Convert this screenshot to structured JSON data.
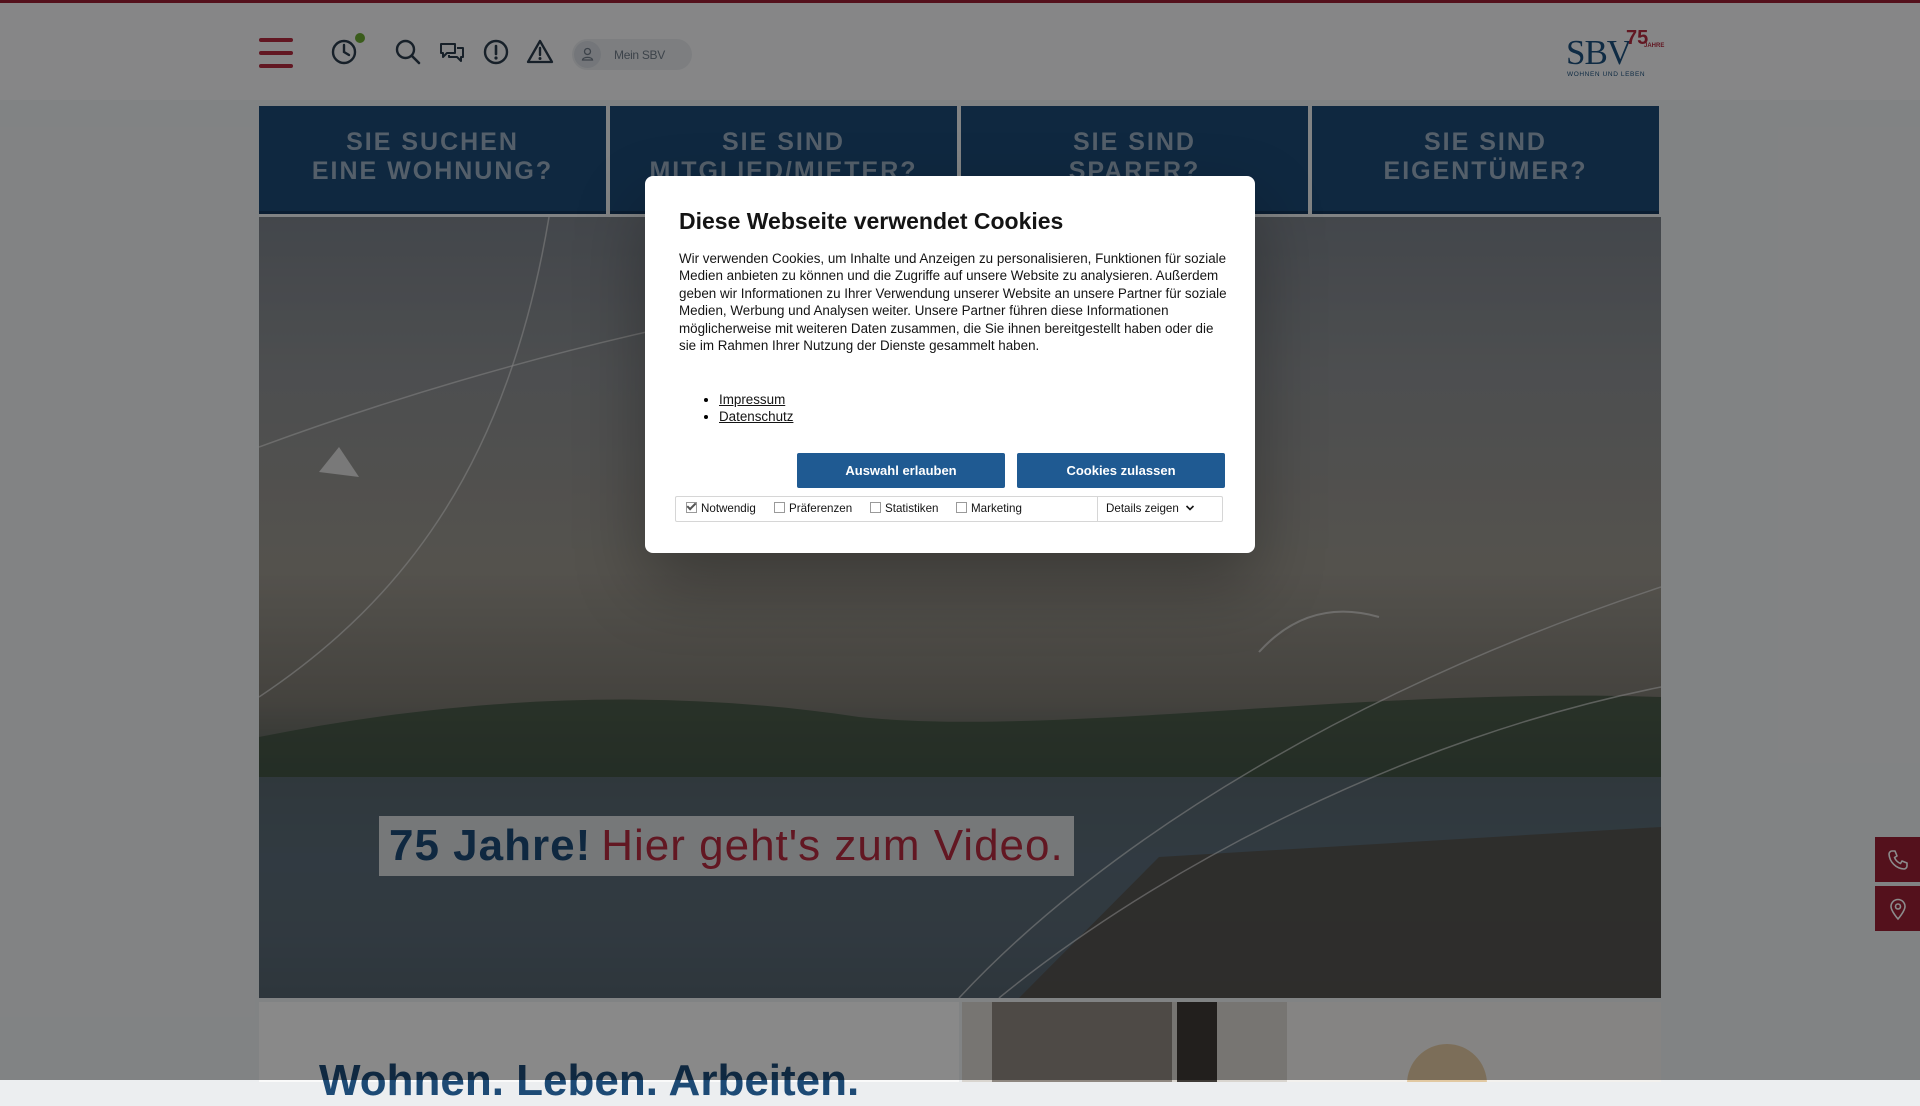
{
  "header": {
    "mein_sbv_label": "Mein SBV",
    "logo": {
      "brand": "SBV",
      "years": "75",
      "years_word": "JAHRE",
      "tagline": "WOHNEN UND LEBEN"
    },
    "icons": [
      "menu-icon",
      "clock-icon",
      "search-icon",
      "chat-icon",
      "info-icon",
      "warning-icon",
      "user-icon"
    ]
  },
  "tiles": [
    {
      "line1": "SIE SUCHEN",
      "line2": "EINE WOHNUNG?"
    },
    {
      "line1": "SIE SIND",
      "line2": "MITGLIED/MIETER?"
    },
    {
      "line1": "SIE SIND",
      "line2": "SPARER?"
    },
    {
      "line1": "SIE SIND",
      "line2": "EIGENTÜMER?"
    }
  ],
  "hero": {
    "caption_bold": "75 Jahre!",
    "caption_link": "Hier geht's zum Video."
  },
  "section": {
    "heading": "Wohnen. Leben. Arbeiten."
  },
  "cookie_dialog": {
    "title": "Diese Webseite verwendet Cookies",
    "body": "Wir verwenden Cookies, um Inhalte und Anzeigen zu personalisieren, Funktionen für soziale Medien anbieten zu können und die Zugriffe auf unsere Website zu analysieren. Außerdem geben wir Informationen zu Ihrer Verwendung unserer Website an unsere Partner für soziale Medien, Werbung und Analysen weiter. Unsere Partner führen diese Informationen möglicherweise mit weiteren Daten zusammen, die Sie ihnen bereitgestellt haben oder die sie im Rahmen Ihrer Nutzung der Dienste gesammelt haben.",
    "links": [
      "Impressum",
      "Datenschutz"
    ],
    "button_selection": "Auswahl erlauben",
    "button_allow": "Cookies zulassen",
    "checkboxes": [
      {
        "label": "Notwendig",
        "checked": true
      },
      {
        "label": "Präferenzen",
        "checked": false
      },
      {
        "label": "Statistiken",
        "checked": false
      },
      {
        "label": "Marketing",
        "checked": false
      }
    ],
    "details_label": "Details zeigen"
  },
  "side_buttons": [
    "phone-icon",
    "location-pin-icon"
  ],
  "colors": {
    "brand_blue": "#1d4a75",
    "brand_red": "#b22a3f",
    "button_blue": "#1f5a92"
  }
}
